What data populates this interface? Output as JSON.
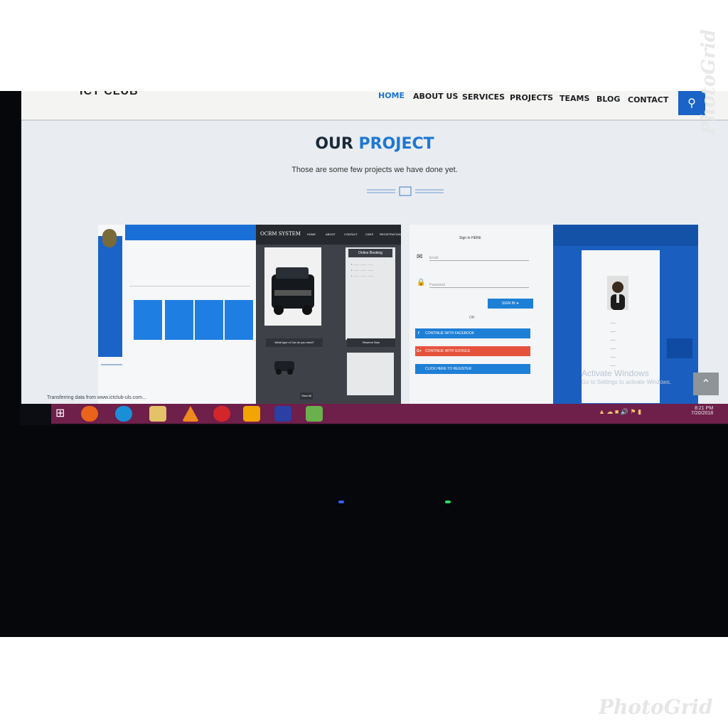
{
  "navbar": {
    "brand": "ICT CLUB",
    "items": [
      "HOME",
      "ABOUT US",
      "SERVICES",
      "PROJECTS",
      "TEAMS",
      "BLOG",
      "CONTACT"
    ]
  },
  "hero": {
    "title_part1": "OUR",
    "title_part2": "PROJECT",
    "subtitle": "Those are some few projects we have done yet."
  },
  "cards": {
    "c2": {
      "title": "OCRM SYSTEM",
      "menu": [
        "HOME",
        "ABOUT",
        "CONTACT",
        "CARS",
        "REGISTRATION"
      ],
      "panel_title": "Online Booking",
      "btn1": "What type of Car do you need?",
      "btn2": "Reserve Now",
      "btn3": "View All"
    },
    "c3": {
      "heading": "Sign In HERE",
      "email_ph": "Email",
      "password_ph": "Password",
      "signin": "SIGN IN",
      "or": "OR",
      "facebook": "CONTINUE WITH FACEBOOK",
      "google": "CONTINUE WITH GOOGLE",
      "register": "CLICK HERE TO REGISTER"
    }
  },
  "overlay": {
    "status": "Transferring data from www.ictclub-uls.com...",
    "activate": "Activate Windows",
    "activate_sub": "Go to Settings to activate Windows."
  },
  "taskbar": {
    "time": "8:21 PM",
    "date": "7/20/2018"
  },
  "watermark": {
    "text": "PhotoGrid"
  },
  "colors": {
    "accent": "#1a74d4",
    "taskbar": "#6e1f4a",
    "facebook": "#1e7fd6",
    "google": "#e5533d"
  }
}
